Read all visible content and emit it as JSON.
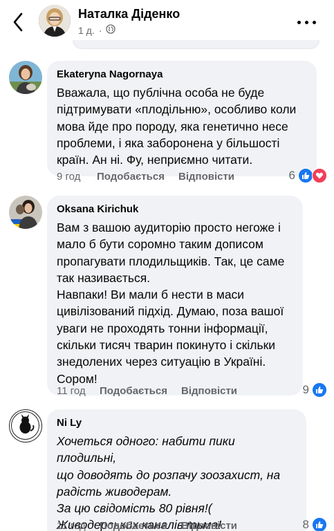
{
  "header": {
    "name": "Наталка Діденко",
    "time": "1 д.",
    "dot": "·"
  },
  "comments": [
    {
      "author": "Ekateryna Nagornaya",
      "text": "Вважала, що публічна особа не буде\nпідтримувати «плодільню», особливо коли\nмова йде про породу, яка генетично несе\nпроблеми, і яка заборонена у більшості\nкраїн. Ан ні. Фу, неприємно читати.",
      "time": "9 год",
      "like_label": "Подобається",
      "reply_label": "Відповісти",
      "reaction_count": "6",
      "reactions": [
        "like-icon",
        "love-icon"
      ]
    },
    {
      "author": "Oksana Kirichuk",
      "text": "Вам з вашою аудиторію просто негоже і\nмало б бути соромно таким дописом\nпропагувати плодильщиків. Так, це саме\nтак називається.\nНавпаки! Ви мали б нести в маси\nцивілізований підхід. Думаю, поза вашої\nуваги не проходять тонни інформації,\nскільки тисяч тварин покинуто і скільки\nзнедолених через ситуацію в Україні.\nСором!",
      "time": "11 год",
      "like_label": "Подобається",
      "reply_label": "Відповісти",
      "reaction_count": "9",
      "reactions": [
        "like-icon"
      ]
    },
    {
      "author": "Ni Ly",
      "text": "Хочеться одного: набити пики плодильні,\nщо доводять до розпачу зоозахист, на\nрадість живодерам.\nЗа цю свідомість 80 рівня!(\nЖиводерських каналів тьма!",
      "time": "11 год",
      "like_label": "Подобається",
      "reply_label": "Відповісти",
      "reaction_count": "8",
      "reactions": [
        "like-icon"
      ],
      "avatar_text": "М'ЯКІ ЛАПКИ ЖИТОМИР"
    }
  ],
  "colors": {
    "bubble": "#f0f2f5",
    "meta": "#65676b",
    "like": "#1877f2",
    "love": "#f33e58"
  }
}
